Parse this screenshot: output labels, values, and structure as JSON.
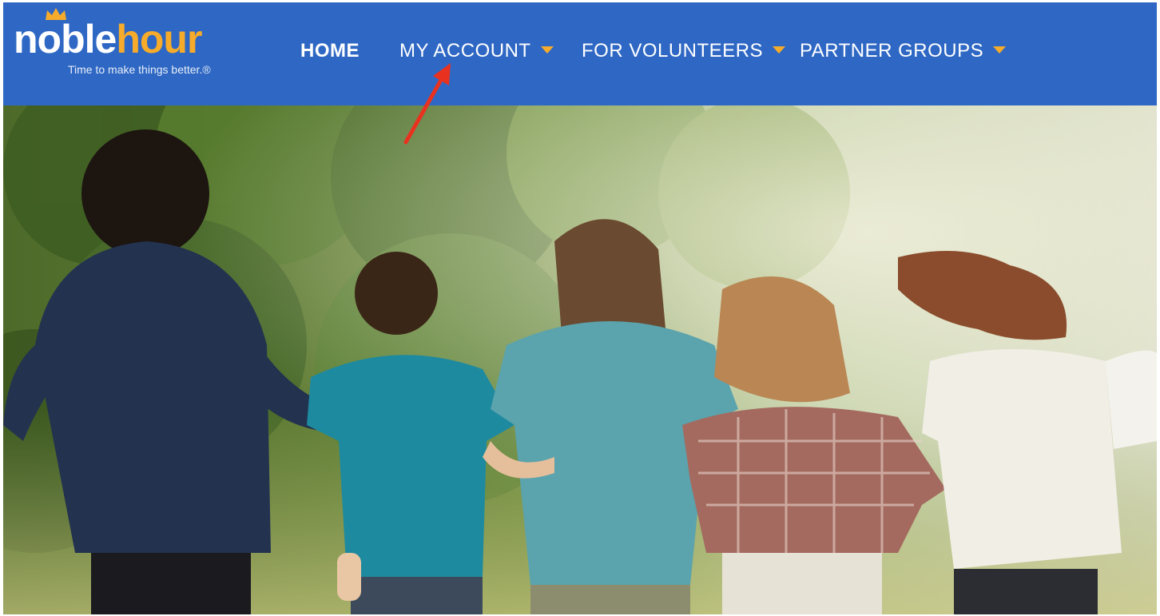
{
  "brand": {
    "logo_text_part1": "noble",
    "logo_text_part2": "hour",
    "tagline": "Time to make things better.®",
    "primary_color": "#2f68c4",
    "accent_color": "#f6ab2a"
  },
  "nav": {
    "items": [
      {
        "label": "HOME",
        "has_dropdown": false,
        "active": true
      },
      {
        "label": "MY ACCOUNT",
        "has_dropdown": true,
        "active": false
      },
      {
        "label": "FOR VOLUNTEERS",
        "has_dropdown": true,
        "active": false
      },
      {
        "label": "PARTNER GROUPS",
        "has_dropdown": true,
        "active": false
      }
    ]
  },
  "hero": {
    "icon": "hero-photo"
  },
  "annotation": {
    "icon": "red-arrow-icon",
    "color": "#e8321f"
  }
}
